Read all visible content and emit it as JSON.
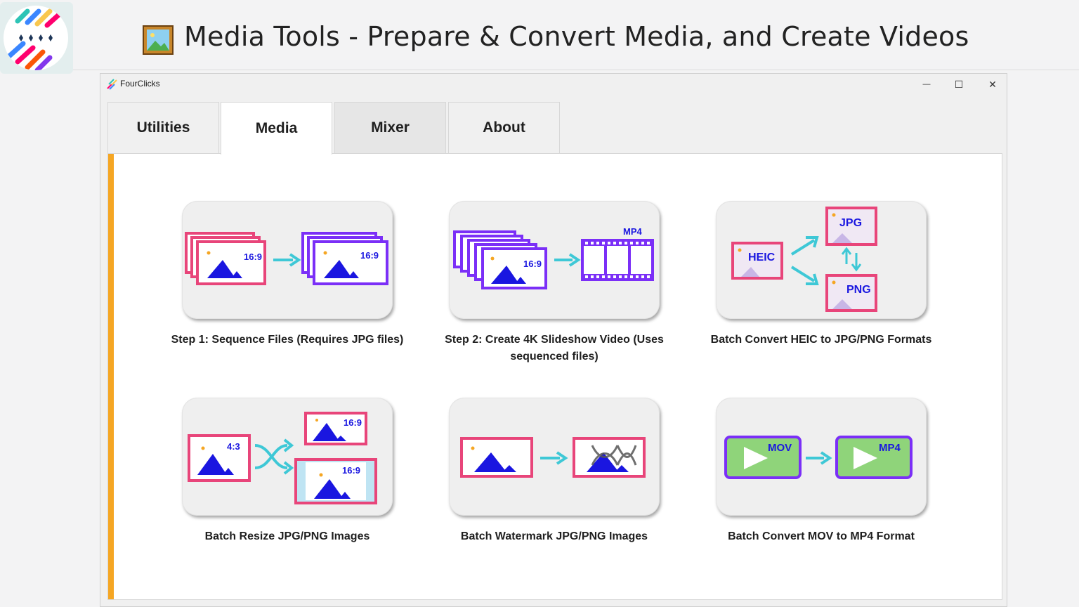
{
  "banner": {
    "title": "Media Tools - Prepare & Convert Media, and Create Videos",
    "logo_icon": "fourclicks-logo-icon",
    "title_icon": "framed-picture-icon"
  },
  "window": {
    "app_name": "FourClicks",
    "minimize_label": "—",
    "maximize_label": "☐",
    "close_label": "✕"
  },
  "tabs": [
    {
      "label": "Utilities",
      "active": false
    },
    {
      "label": "Media",
      "active": true
    },
    {
      "label": "Mixer",
      "active": false
    },
    {
      "label": "About",
      "active": false
    }
  ],
  "tools": [
    {
      "caption": "Step 1: Sequence Files (Requires JPG files)",
      "badges": [
        "16:9",
        "16:9"
      ]
    },
    {
      "caption": "Step 2: Create 4K Slideshow Video (Uses sequenced files)",
      "badges": [
        "16:9",
        "MP4"
      ]
    },
    {
      "caption": "Batch Convert HEIC to JPG/PNG Formats",
      "badges": [
        "HEIC",
        "JPG",
        "PNG"
      ]
    },
    {
      "caption": "Batch Resize JPG/PNG Images",
      "badges": [
        "4:3",
        "16:9",
        "16:9"
      ]
    },
    {
      "caption": "Batch Watermark JPG/PNG Images",
      "badges": []
    },
    {
      "caption": "Batch Convert MOV to MP4 Format",
      "badges": [
        "MOV",
        "MP4"
      ]
    }
  ],
  "colors": {
    "accent": "#f5a623",
    "pink": "#e8457a",
    "purple": "#7b2ff7",
    "blue": "#1a16e0",
    "cyan": "#3ec8d6",
    "green": "#8fd47a"
  }
}
